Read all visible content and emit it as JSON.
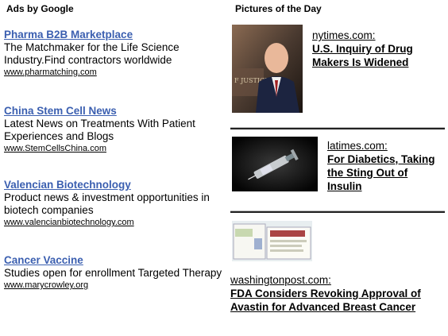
{
  "ads": {
    "heading": "Ads by Google",
    "items": [
      {
        "title": "Pharma B2B Marketplace",
        "description": "The Matchmaker for the Life Science Industry.Find contractors worldwide",
        "url": "www.pharmatching.com"
      },
      {
        "title": "China Stem Cell News",
        "description": "Latest News on Treatments With Patient Experiences and Blogs",
        "url": "www.StemCellsChina.com"
      },
      {
        "title": "Valencian Biotechnology",
        "description": "Product news & investment opportunities in biotech companies",
        "url": "www.valencianbiotechnology.com"
      },
      {
        "title": "Cancer Vaccine",
        "description": "Studies open for enrollment Targeted Therapy",
        "url": "www.marycrowley.org"
      }
    ]
  },
  "pictures": {
    "heading": "Pictures of the Day",
    "items": [
      {
        "source": "nytimes.com:",
        "headline": "U.S. Inquiry of Drug Makers Is Widened",
        "thumb_icon": "official-at-podium-photo"
      },
      {
        "source": "latimes.com:",
        "headline": "For Diabetics, Taking the Sting Out of Insulin",
        "thumb_icon": "syringe-photo"
      },
      {
        "source": "washingtonpost.com:",
        "headline": "FDA Considers Revoking Approval of Avastin for Advanced Breast Cancer",
        "thumb_icon": "avastin-box-photo"
      }
    ]
  },
  "colors": {
    "ad_title": "#3b5fb0",
    "text": "#000000",
    "background": "#ffffff"
  }
}
